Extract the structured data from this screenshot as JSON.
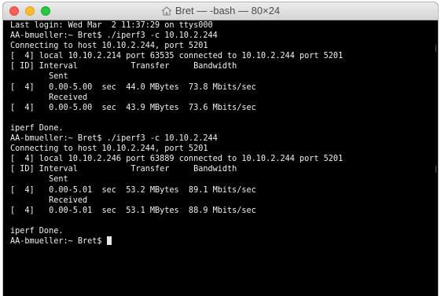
{
  "window": {
    "title": "Bret — -bash — 80×24",
    "title_icon": "home-icon"
  },
  "terminal": {
    "lines": [
      {
        "text": "Last login: Wed Mar  2 11:37:29 on ttys000"
      },
      {
        "text": "AA-bmueller:~ Bret$ ./iperf3 -c 10.10.2.244"
      },
      {
        "text": "Connecting to host 10.10.2.244, port 5201"
      },
      {
        "text": "[  4] local 10.10.2.214 port 63535 connected to 10.10.2.244 port 5201"
      },
      {
        "text": "[ ID] Interval           Transfer     Bandwidth"
      },
      {
        "text": "        Sent"
      },
      {
        "text": "[  4]   0.00-5.00  sec  44.0 MBytes  73.8 Mbits/sec"
      },
      {
        "text": "        Received"
      },
      {
        "text": "[  4]   0.00-5.00  sec  43.9 MBytes  73.6 Mbits/sec"
      },
      {
        "text": ""
      },
      {
        "text": "iperf Done."
      },
      {
        "text": "AA-bmueller:~ Bret$ ./iperf3 -c 10.10.2.244"
      },
      {
        "text": "Connecting to host 10.10.2.244, port 5201"
      },
      {
        "text": "[  4] local 10.10.2.246 port 63889 connected to 10.10.2.244 port 5201"
      },
      {
        "text": "[ ID] Interval           Transfer     Bandwidth"
      },
      {
        "text": "        Sent"
      },
      {
        "text": "[  4]   0.00-5.01  sec  53.2 MBytes  89.1 Mbits/sec"
      },
      {
        "text": "        Received"
      },
      {
        "text": "[  4]   0.00-5.01  sec  53.1 MBytes  88.9 Mbits/sec"
      },
      {
        "text": ""
      },
      {
        "text": "iperf Done."
      }
    ],
    "prompt": "AA-bmueller:~ Bret$ "
  },
  "colors": {
    "background": "#000000",
    "foreground": "#f0f0f0",
    "close": "#fc5f57",
    "minimize": "#fdbc2e",
    "zoom": "#28c840"
  }
}
